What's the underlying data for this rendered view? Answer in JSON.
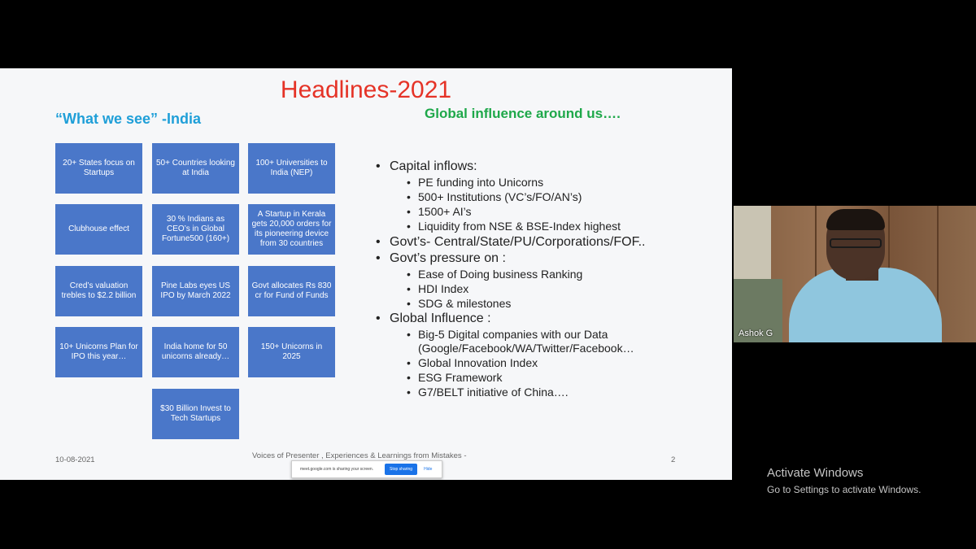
{
  "slide": {
    "title": "Headlines-2021",
    "india_heading": "“What we see” -India",
    "global_heading": "Global influence around us….",
    "tiles": [
      "20+ States focus on Startups",
      "50+ Countries looking at India",
      "100+ Universities to India (NEP)",
      "Clubhouse effect",
      "30 % Indians as CEO’s in Global Fortune500 (160+)",
      "A Startup in Kerala gets 20,000 orders for its pioneering device from 30 countries",
      "Cred’s valuation trebles to $2.2 billion",
      "Pine Labs eyes US IPO by March 2022",
      "Govt allocates Rs 830 cr for Fund of Funds",
      "10+ Unicorns Plan for IPO this year…",
      "India home for 50 unicorns already…",
      "150+ Unicorns in 2025",
      "$30 Billion Invest to Tech Startups"
    ],
    "bullets": [
      {
        "text": "Capital inflows:",
        "subs": [
          "PE funding into Unicorns",
          "500+ Institutions (VC’s/FO/AN’s)",
          "1500+ AI’s",
          "Liquidity from NSE & BSE-Index highest"
        ]
      },
      {
        "text": "Govt’s- Central/State/PU/Corporations/FOF..",
        "subs": []
      },
      {
        "text": "Govt’s pressure on :",
        "subs": [
          "Ease of Doing business Ranking",
          "HDI Index",
          "SDG & milestones"
        ]
      },
      {
        "text": "Global Influence :",
        "subs": [
          "Big-5 Digital companies with our Data (Google/Facebook/WA/Twitter/Facebook…",
          "Global Innovation Index",
          "ESG Framework",
          "G7/BELT initiative of China…."
        ]
      }
    ],
    "footer_date": "10-08-2021",
    "footer_center": "Voices of Presenter , Experiences & Learnings from Mistakes -",
    "page_number": "2"
  },
  "share_bar": {
    "text": "meet.google.com is sharing your screen.",
    "stop_label": "Stop sharing",
    "hide_label": "Hide"
  },
  "participant": {
    "name": "Ashok G"
  },
  "watermark": {
    "line1": "Activate Windows",
    "line2": "Go to Settings to activate Windows."
  }
}
